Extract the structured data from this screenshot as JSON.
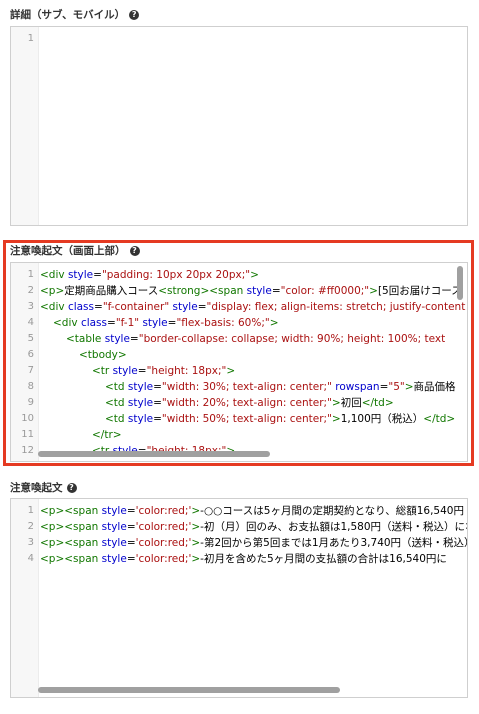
{
  "section1": {
    "label": "詳細（サブ、モバイル）",
    "lines": [
      "1"
    ]
  },
  "section2": {
    "label": "注意喚起文（画面上部）",
    "lines": [
      {
        "n": "1",
        "indent": 0,
        "tokens": [
          [
            "tag",
            "<div "
          ],
          [
            "attr",
            "style"
          ],
          [
            "txt",
            "="
          ],
          [
            "str",
            "\"padding: 10px 20px 20px;\""
          ],
          [
            "tag",
            ">"
          ]
        ]
      },
      {
        "n": "2",
        "indent": 0,
        "tokens": [
          [
            "tag",
            "<p>"
          ],
          [
            "txt",
            "定期商品購入コース"
          ],
          [
            "tag",
            "<strong><span "
          ],
          [
            "attr",
            "style"
          ],
          [
            "txt",
            "="
          ],
          [
            "str",
            "\"color: #ff0000;\""
          ],
          [
            "tag",
            ">"
          ],
          [
            "txt",
            "[5回お届けコース"
          ]
        ]
      },
      {
        "n": "3",
        "indent": 0,
        "tokens": [
          [
            "tag",
            "<div "
          ],
          [
            "attr",
            "class"
          ],
          [
            "txt",
            "="
          ],
          [
            "str",
            "\"f-container\""
          ],
          [
            "txt",
            " "
          ],
          [
            "attr",
            "style"
          ],
          [
            "txt",
            "="
          ],
          [
            "str",
            "\"display: flex; align-items: stretch; justify-content"
          ]
        ]
      },
      {
        "n": "4",
        "indent": 1,
        "tokens": [
          [
            "tag",
            "<div "
          ],
          [
            "attr",
            "class"
          ],
          [
            "txt",
            "="
          ],
          [
            "str",
            "\"f-1\""
          ],
          [
            "txt",
            " "
          ],
          [
            "attr",
            "style"
          ],
          [
            "txt",
            "="
          ],
          [
            "str",
            "\"flex-basis: 60%;\""
          ],
          [
            "tag",
            ">"
          ]
        ]
      },
      {
        "n": "5",
        "indent": 2,
        "tokens": [
          [
            "tag",
            "<table "
          ],
          [
            "attr",
            "style"
          ],
          [
            "txt",
            "="
          ],
          [
            "str",
            "\"border-collapse: collapse; width: 90%; height: 100%; text"
          ]
        ]
      },
      {
        "n": "6",
        "indent": 3,
        "tokens": [
          [
            "tag",
            "<tbody>"
          ]
        ]
      },
      {
        "n": "7",
        "indent": 4,
        "tokens": [
          [
            "tag",
            "<tr "
          ],
          [
            "attr",
            "style"
          ],
          [
            "txt",
            "="
          ],
          [
            "str",
            "\"height: 18px;\""
          ],
          [
            "tag",
            ">"
          ]
        ]
      },
      {
        "n": "8",
        "indent": 5,
        "tokens": [
          [
            "tag",
            "<td "
          ],
          [
            "attr",
            "style"
          ],
          [
            "txt",
            "="
          ],
          [
            "str",
            "\"width: 30%; text-align: center;\""
          ],
          [
            "txt",
            " "
          ],
          [
            "attr",
            "rowspan"
          ],
          [
            "txt",
            "="
          ],
          [
            "str",
            "\"5\""
          ],
          [
            "tag",
            ">"
          ],
          [
            "txt",
            "商品価格"
          ]
        ]
      },
      {
        "n": "9",
        "indent": 5,
        "tokens": [
          [
            "tag",
            "<td "
          ],
          [
            "attr",
            "style"
          ],
          [
            "txt",
            "="
          ],
          [
            "str",
            "\"width: 20%; text-align: center;\""
          ],
          [
            "tag",
            ">"
          ],
          [
            "txt",
            "初回"
          ],
          [
            "tag",
            "</td>"
          ]
        ]
      },
      {
        "n": "10",
        "indent": 5,
        "tokens": [
          [
            "tag",
            "<td "
          ],
          [
            "attr",
            "style"
          ],
          [
            "txt",
            "="
          ],
          [
            "str",
            "\"width: 50%; text-align: center;\""
          ],
          [
            "tag",
            ">"
          ],
          [
            "txt",
            "1,100円（税込）"
          ],
          [
            "tag",
            "</td>"
          ]
        ]
      },
      {
        "n": "11",
        "indent": 4,
        "tokens": [
          [
            "tag",
            "</tr>"
          ]
        ]
      },
      {
        "n": "12",
        "indent": 4,
        "tokens": [
          [
            "tag",
            "<tr "
          ],
          [
            "attr",
            "style"
          ],
          [
            "txt",
            "="
          ],
          [
            "str",
            "\"height: 18px;\""
          ],
          [
            "tag",
            ">"
          ]
        ]
      }
    ]
  },
  "section3": {
    "label": "注意喚起文",
    "lines": [
      {
        "n": "1",
        "indent": 0,
        "tokens": [
          [
            "tag",
            "<p><span "
          ],
          [
            "attr",
            "style"
          ],
          [
            "txt",
            "="
          ],
          [
            "str",
            "'color:red;'"
          ],
          [
            "tag",
            ">"
          ],
          [
            "txt",
            "-○○コースは5ヶ月間の定期契約となり、総額16,540円"
          ]
        ]
      },
      {
        "n": "2",
        "indent": 0,
        "tokens": [
          [
            "tag",
            "<p><span "
          ],
          [
            "attr",
            "style"
          ],
          [
            "txt",
            "="
          ],
          [
            "str",
            "'color:red;'"
          ],
          [
            "tag",
            ">"
          ],
          [
            "txt",
            "-初（月）回のみ、お支払額は1,580円（送料・税込）になります"
          ]
        ]
      },
      {
        "n": "3",
        "indent": 0,
        "tokens": [
          [
            "tag",
            "<p><span "
          ],
          [
            "attr",
            "style"
          ],
          [
            "txt",
            "="
          ],
          [
            "str",
            "'color:red;'"
          ],
          [
            "tag",
            ">"
          ],
          [
            "txt",
            "-第2回から第5回までは1月あたり3,740円（送料・税込）"
          ]
        ]
      },
      {
        "n": "4",
        "indent": 0,
        "tokens": [
          [
            "tag",
            "<p><span "
          ],
          [
            "attr",
            "style"
          ],
          [
            "txt",
            "="
          ],
          [
            "str",
            "'color:red;'"
          ],
          [
            "tag",
            ">"
          ],
          [
            "txt",
            "-初月を含めた5ヶ月間の支払額の合計は16,540円に"
          ]
        ]
      }
    ]
  },
  "icons": {
    "help": "question-circle-icon"
  },
  "colors": {
    "highlight": "#e53a22",
    "tag": "#117700",
    "attr": "#0000cc",
    "string": "#aa1111"
  }
}
